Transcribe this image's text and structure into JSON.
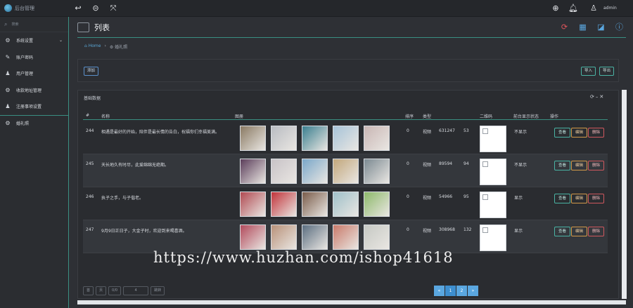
{
  "app": {
    "brand": "后台管理",
    "admin_user": "admin"
  },
  "topbar": {
    "icons": [
      "back-icon",
      "refresh-circle-icon",
      "fullscreen-icon",
      "download-icon",
      "bell-icon",
      "user-icon"
    ]
  },
  "sidebar": {
    "search_placeholder": "搜索",
    "items": [
      {
        "label": "系统设置",
        "icon": "gear-icon",
        "has_children": true
      },
      {
        "label": "账户密码",
        "icon": "pencil-icon"
      },
      {
        "label": "用户管理",
        "icon": "users-icon"
      },
      {
        "label": "收款地址管理",
        "icon": "gear-icon"
      },
      {
        "label": "注册事项设置",
        "icon": "users-icon"
      },
      {
        "label": "婚礼照",
        "icon": "gear-icon",
        "active": true
      }
    ]
  },
  "page": {
    "title": "列表",
    "breadcrumb": {
      "home": "Home",
      "separator": "›",
      "current": "婚礼照"
    },
    "header_icons": [
      "sync-icon",
      "grid-icon",
      "edit-icon",
      "help-icon"
    ]
  },
  "toolbar": {
    "add_label": "添加",
    "import_label": "导入",
    "export_label": "导出"
  },
  "panel": {
    "title": "基础数据"
  },
  "table": {
    "headers": [
      "#",
      "名称",
      "图册",
      "排序",
      "类型",
      "",
      "",
      "二维码",
      "前台显示状态",
      "操作"
    ],
    "rows": [
      {
        "id": "244",
        "name": "相遇是最好的开始，陪伴是最长情的告白，祝福你们幸福美满。",
        "sort": "0",
        "type": "视频",
        "views": "631247",
        "count": "53",
        "status": "不显示",
        "actions": [
          "查看",
          "编辑",
          "删除"
        ],
        "thumb_colors": [
          "#8a7a63",
          "#b9bcc2",
          "#3a7f8f",
          "#a6c3d8",
          "#c9b6b4"
        ]
      },
      {
        "id": "245",
        "name": "天长地久有时尽，此爱绵绵无绝期。",
        "sort": "0",
        "type": "视频",
        "views": "89594",
        "count": "94",
        "status": "不显示",
        "actions": [
          "查看",
          "编辑",
          "删除"
        ],
        "thumb_colors": [
          "#5b3d5a",
          "#c8c3c7",
          "#7aa7c9",
          "#c2a77c",
          "#7c8a92"
        ]
      },
      {
        "id": "246",
        "name": "执子之手，与子偕老。",
        "sort": "0",
        "type": "视频",
        "views": "54966",
        "count": "95",
        "status": "显示",
        "actions": [
          "查看",
          "编辑",
          "删除"
        ],
        "thumb_colors": [
          "#b04a52",
          "#c2333a",
          "#7a5c4a",
          "#9fc0c9",
          "#8db96a"
        ]
      },
      {
        "id": "247",
        "name": "9月9日正日子，大金子时，欢迎到来喝喜酒。",
        "sort": "0",
        "type": "视频",
        "views": "308968",
        "count": "132",
        "status": "显示",
        "actions": [
          "查看",
          "编辑",
          "删除"
        ],
        "thumb_colors": [
          "#b24a5c",
          "#b9927a",
          "#5b6e80",
          "#c97a6a",
          "#c6c9c4"
        ]
      }
    ]
  },
  "pagination": {
    "left": [
      "首",
      "页",
      "0/0",
      "4",
      "跳转"
    ],
    "pages": [
      "«",
      "1",
      "2",
      "»"
    ],
    "current": "1"
  },
  "watermark": "https://www.huzhan.com/ishop41618",
  "colors": {
    "accent": "#3a8f82",
    "background": "#2e3035",
    "primary_blue": "#5aa7e0",
    "danger": "#d0585e",
    "warning": "#d29a4a"
  }
}
